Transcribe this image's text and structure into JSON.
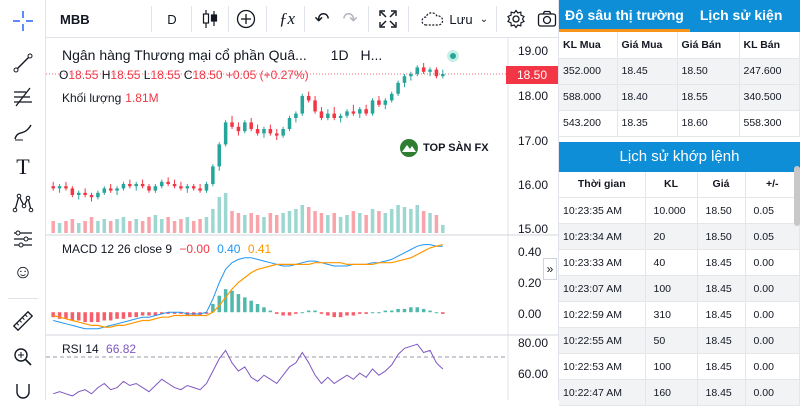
{
  "toolbar": {
    "symbol": "MBB",
    "interval": "D",
    "save_label": "Lưu"
  },
  "icons": {
    "crosshair": "crosshair-icon",
    "trendline": "trendline-icon",
    "fib": "fib-icon",
    "brush": "brush-icon",
    "text": "text-icon",
    "pattern": "pattern-icon",
    "indicator": "indicator-icon",
    "emoji": "emoji-icon",
    "ruler": "ruler-icon",
    "zoom": "zoom-icon",
    "candles": "candlestick-icon",
    "add": "add-icon",
    "fx": "fx-icon",
    "undo": "undo-icon",
    "redo": "redo-icon",
    "fullscreen": "fullscreen-icon",
    "cloud": "cloud-icon",
    "chevron": "chevron-down-icon",
    "settings": "gear-icon",
    "camera": "camera-icon"
  },
  "legend": {
    "title": "Ngân hàng Thương mại cổ phần Quâ...",
    "interval": "1D",
    "extra": "H...",
    "o_label": "O",
    "o": "18.55",
    "h_label": "H",
    "h": "18.55",
    "l_label": "L",
    "l": "18.55",
    "c_label": "C",
    "c": "18.50",
    "change": "+0.05 (+0.27%)",
    "volume_label": "Khối lượng",
    "volume": "1.81M",
    "macd_label": "MACD 12 26 close 9",
    "macd_v1": "−0.00",
    "macd_v2": "0.40",
    "macd_v3": "0.41",
    "rsi_label": "RSI 14",
    "rsi_value": "66.82"
  },
  "price_tag": "18.50",
  "price_axis": [
    "19.00",
    "18.00",
    "17.00",
    "16.00",
    "15.00"
  ],
  "macd_axis": [
    "0.40",
    "0.20",
    "0.00"
  ],
  "rsi_axis": [
    "80.00",
    "60.00"
  ],
  "watermark": "TOP SÀN FX",
  "collapse": "»",
  "colors": {
    "up": "#26a69a",
    "down": "#f23645",
    "accent": "#0d8ed6",
    "tab_underline": "#f7931a"
  },
  "panel": {
    "tab1": "Độ sâu thị trường",
    "tab2": "Lịch sử kiện",
    "depth_headers": [
      "KL Mua",
      "Giá Mua",
      "Giá Bán",
      "KL Bán"
    ],
    "depth_rows": [
      [
        "352.000",
        "18.45",
        "18.50",
        "247.600"
      ],
      [
        "588.000",
        "18.40",
        "18.55",
        "340.500"
      ],
      [
        "543.200",
        "18.35",
        "18.60",
        "558.300"
      ]
    ],
    "history_title": "Lịch sử khớp lệnh",
    "history_headers": [
      "Thời gian",
      "KL",
      "Giá",
      "+/-"
    ],
    "history_rows": [
      [
        "10:23:35 AM",
        "10.000",
        "18.50",
        "0.05"
      ],
      [
        "10:23:34 AM",
        "20",
        "18.50",
        "0.05"
      ],
      [
        "10:23:33 AM",
        "40",
        "18.45",
        "0.00"
      ],
      [
        "10:23:07 AM",
        "100",
        "18.45",
        "0.00"
      ],
      [
        "10:22:59 AM",
        "310",
        "18.45",
        "0.00"
      ],
      [
        "10:22:55 AM",
        "50",
        "18.45",
        "0.00"
      ],
      [
        "10:22:53 AM",
        "100",
        "18.45",
        "0.00"
      ],
      [
        "10:22:47 AM",
        "160",
        "18.45",
        "0.00"
      ]
    ]
  },
  "chart_data": {
    "type": "candlestick",
    "price_min": 15.0,
    "price_max": 19.0,
    "candles": [
      {
        "o": 15.95,
        "h": 16.05,
        "l": 15.85,
        "c": 15.9
      },
      {
        "o": 15.9,
        "h": 16.0,
        "l": 15.8,
        "c": 15.95
      },
      {
        "o": 15.95,
        "h": 16.05,
        "l": 15.85,
        "c": 15.9
      },
      {
        "o": 15.9,
        "h": 15.95,
        "l": 15.7,
        "c": 15.75
      },
      {
        "o": 15.75,
        "h": 15.85,
        "l": 15.65,
        "c": 15.8
      },
      {
        "o": 15.8,
        "h": 15.9,
        "l": 15.7,
        "c": 15.75
      },
      {
        "o": 15.75,
        "h": 15.8,
        "l": 15.6,
        "c": 15.7
      },
      {
        "o": 15.7,
        "h": 15.85,
        "l": 15.65,
        "c": 15.8
      },
      {
        "o": 15.8,
        "h": 15.95,
        "l": 15.75,
        "c": 15.9
      },
      {
        "o": 15.9,
        "h": 16.0,
        "l": 15.8,
        "c": 15.85
      },
      {
        "o": 15.85,
        "h": 15.95,
        "l": 15.75,
        "c": 15.9
      },
      {
        "o": 15.9,
        "h": 16.05,
        "l": 15.85,
        "c": 16.0
      },
      {
        "o": 16.0,
        "h": 16.1,
        "l": 15.9,
        "c": 15.95
      },
      {
        "o": 15.95,
        "h": 16.05,
        "l": 15.85,
        "c": 16.0
      },
      {
        "o": 16.0,
        "h": 16.1,
        "l": 15.9,
        "c": 15.95
      },
      {
        "o": 15.95,
        "h": 16.0,
        "l": 15.8,
        "c": 15.85
      },
      {
        "o": 15.85,
        "h": 16.0,
        "l": 15.8,
        "c": 15.95
      },
      {
        "o": 15.95,
        "h": 16.1,
        "l": 15.9,
        "c": 16.05
      },
      {
        "o": 16.05,
        "h": 16.15,
        "l": 15.95,
        "c": 16.0
      },
      {
        "o": 16.0,
        "h": 16.1,
        "l": 15.9,
        "c": 15.95
      },
      {
        "o": 15.95,
        "h": 16.05,
        "l": 15.85,
        "c": 15.9
      },
      {
        "o": 15.9,
        "h": 16.0,
        "l": 15.8,
        "c": 15.95
      },
      {
        "o": 15.95,
        "h": 16.0,
        "l": 15.85,
        "c": 15.9
      },
      {
        "o": 15.9,
        "h": 16.0,
        "l": 15.8,
        "c": 15.85
      },
      {
        "o": 15.85,
        "h": 16.05,
        "l": 15.8,
        "c": 16.0
      },
      {
        "o": 16.0,
        "h": 16.45,
        "l": 15.95,
        "c": 16.4
      },
      {
        "o": 16.4,
        "h": 16.95,
        "l": 16.3,
        "c": 16.9
      },
      {
        "o": 16.9,
        "h": 17.45,
        "l": 16.85,
        "c": 17.4
      },
      {
        "o": 17.4,
        "h": 17.55,
        "l": 17.25,
        "c": 17.3
      },
      {
        "o": 17.3,
        "h": 17.4,
        "l": 17.1,
        "c": 17.2
      },
      {
        "o": 17.2,
        "h": 17.45,
        "l": 17.15,
        "c": 17.4
      },
      {
        "o": 17.4,
        "h": 17.5,
        "l": 17.2,
        "c": 17.25
      },
      {
        "o": 17.25,
        "h": 17.35,
        "l": 17.1,
        "c": 17.15
      },
      {
        "o": 17.15,
        "h": 17.3,
        "l": 17.05,
        "c": 17.25
      },
      {
        "o": 17.25,
        "h": 17.35,
        "l": 17.1,
        "c": 17.15
      },
      {
        "o": 17.15,
        "h": 17.25,
        "l": 17.0,
        "c": 17.1
      },
      {
        "o": 17.1,
        "h": 17.3,
        "l": 17.05,
        "c": 17.25
      },
      {
        "o": 17.25,
        "h": 17.55,
        "l": 17.2,
        "c": 17.5
      },
      {
        "o": 17.5,
        "h": 17.65,
        "l": 17.4,
        "c": 17.6
      },
      {
        "o": 17.6,
        "h": 18.05,
        "l": 17.55,
        "c": 18.0
      },
      {
        "o": 18.0,
        "h": 18.1,
        "l": 17.85,
        "c": 17.9
      },
      {
        "o": 17.9,
        "h": 18.0,
        "l": 17.6,
        "c": 17.65
      },
      {
        "o": 17.65,
        "h": 17.75,
        "l": 17.45,
        "c": 17.5
      },
      {
        "o": 17.5,
        "h": 17.7,
        "l": 17.45,
        "c": 17.6
      },
      {
        "o": 17.6,
        "h": 17.75,
        "l": 17.45,
        "c": 17.5
      },
      {
        "o": 17.5,
        "h": 17.6,
        "l": 17.4,
        "c": 17.55
      },
      {
        "o": 17.55,
        "h": 17.7,
        "l": 17.5,
        "c": 17.65
      },
      {
        "o": 17.65,
        "h": 17.8,
        "l": 17.55,
        "c": 17.6
      },
      {
        "o": 17.6,
        "h": 17.75,
        "l": 17.5,
        "c": 17.7
      },
      {
        "o": 17.7,
        "h": 17.8,
        "l": 17.55,
        "c": 17.6
      },
      {
        "o": 17.6,
        "h": 17.95,
        "l": 17.55,
        "c": 17.9
      },
      {
        "o": 17.9,
        "h": 18.0,
        "l": 17.75,
        "c": 17.8
      },
      {
        "o": 17.8,
        "h": 17.95,
        "l": 17.7,
        "c": 17.9
      },
      {
        "o": 17.9,
        "h": 18.1,
        "l": 17.85,
        "c": 18.05
      },
      {
        "o": 18.05,
        "h": 18.35,
        "l": 18.0,
        "c": 18.3
      },
      {
        "o": 18.3,
        "h": 18.5,
        "l": 18.2,
        "c": 18.45
      },
      {
        "o": 18.45,
        "h": 18.55,
        "l": 18.35,
        "c": 18.5
      },
      {
        "o": 18.5,
        "h": 18.7,
        "l": 18.45,
        "c": 18.65
      },
      {
        "o": 18.65,
        "h": 18.75,
        "l": 18.5,
        "c": 18.55
      },
      {
        "o": 18.55,
        "h": 18.65,
        "l": 18.45,
        "c": 18.6
      },
      {
        "o": 18.6,
        "h": 18.65,
        "l": 18.4,
        "c": 18.45
      },
      {
        "o": 18.45,
        "h": 18.6,
        "l": 18.4,
        "c": 18.5
      }
    ],
    "volume": [
      0.3,
      0.25,
      0.3,
      0.35,
      0.25,
      0.3,
      0.4,
      0.3,
      0.35,
      0.3,
      0.35,
      0.4,
      0.3,
      0.35,
      0.3,
      0.4,
      0.45,
      0.35,
      0.4,
      0.3,
      0.35,
      0.4,
      0.3,
      0.35,
      0.4,
      0.6,
      0.9,
      1.0,
      0.55,
      0.5,
      0.45,
      0.5,
      0.45,
      0.4,
      0.5,
      0.45,
      0.5,
      0.55,
      0.6,
      0.7,
      0.65,
      0.55,
      0.5,
      0.45,
      0.5,
      0.4,
      0.45,
      0.55,
      0.5,
      0.45,
      0.6,
      0.55,
      0.5,
      0.6,
      0.7,
      0.65,
      0.6,
      0.7,
      0.55,
      0.5,
      0.45,
      0.2
    ],
    "macd_min": -0.12,
    "macd_max": 0.45,
    "macd_hist": [
      -0.03,
      -0.04,
      -0.04,
      -0.05,
      -0.05,
      -0.06,
      -0.06,
      -0.06,
      -0.05,
      -0.05,
      -0.04,
      -0.04,
      -0.03,
      -0.03,
      -0.02,
      -0.02,
      -0.02,
      -0.01,
      -0.01,
      -0.01,
      -0.01,
      -0.02,
      -0.02,
      -0.02,
      -0.01,
      0.05,
      0.1,
      0.14,
      0.13,
      0.11,
      0.09,
      0.07,
      0.05,
      0.03,
      0.01,
      -0.01,
      -0.02,
      -0.02,
      -0.01,
      0.0,
      0.01,
      0.01,
      -0.01,
      -0.02,
      -0.03,
      -0.03,
      -0.02,
      -0.02,
      -0.01,
      -0.01,
      0.0,
      0.0,
      0.01,
      0.01,
      0.02,
      0.02,
      0.03,
      0.03,
      0.02,
      0.01,
      0.0,
      -0.01
    ],
    "macd_line": [
      -0.05,
      -0.06,
      -0.07,
      -0.08,
      -0.09,
      -0.1,
      -0.1,
      -0.1,
      -0.09,
      -0.08,
      -0.07,
      -0.06,
      -0.05,
      -0.04,
      -0.03,
      -0.03,
      -0.02,
      -0.01,
      0.0,
      0.0,
      0.0,
      -0.01,
      -0.01,
      -0.01,
      0.0,
      0.08,
      0.18,
      0.26,
      0.3,
      0.32,
      0.33,
      0.33,
      0.32,
      0.31,
      0.3,
      0.29,
      0.28,
      0.28,
      0.29,
      0.3,
      0.31,
      0.31,
      0.3,
      0.29,
      0.28,
      0.28,
      0.28,
      0.29,
      0.29,
      0.29,
      0.3,
      0.3,
      0.31,
      0.32,
      0.34,
      0.36,
      0.38,
      0.4,
      0.41,
      0.41,
      0.4,
      0.4
    ],
    "signal_line": [
      -0.02,
      -0.03,
      -0.04,
      -0.05,
      -0.06,
      -0.07,
      -0.08,
      -0.08,
      -0.09,
      -0.09,
      -0.08,
      -0.08,
      -0.07,
      -0.06,
      -0.05,
      -0.05,
      -0.04,
      -0.03,
      -0.03,
      -0.02,
      -0.02,
      -0.02,
      -0.02,
      -0.02,
      -0.02,
      0.0,
      0.04,
      0.09,
      0.14,
      0.18,
      0.21,
      0.24,
      0.26,
      0.27,
      0.28,
      0.29,
      0.29,
      0.29,
      0.29,
      0.29,
      0.29,
      0.3,
      0.3,
      0.3,
      0.3,
      0.3,
      0.29,
      0.29,
      0.29,
      0.29,
      0.29,
      0.3,
      0.3,
      0.3,
      0.31,
      0.32,
      0.33,
      0.35,
      0.37,
      0.39,
      0.4,
      0.41
    ],
    "rsi_min": 52,
    "rsi_max": 82,
    "rsi": [
      55,
      56,
      55,
      54,
      56,
      57,
      55,
      58,
      60,
      57,
      58,
      61,
      59,
      60,
      58,
      56,
      59,
      62,
      60,
      58,
      57,
      59,
      58,
      57,
      60,
      66,
      72,
      76,
      70,
      66,
      68,
      63,
      61,
      64,
      62,
      60,
      64,
      68,
      70,
      75,
      70,
      64,
      60,
      63,
      60,
      62,
      64,
      62,
      65,
      63,
      67,
      64,
      66,
      69,
      74,
      77,
      78,
      79,
      75,
      76,
      70,
      67
    ]
  }
}
